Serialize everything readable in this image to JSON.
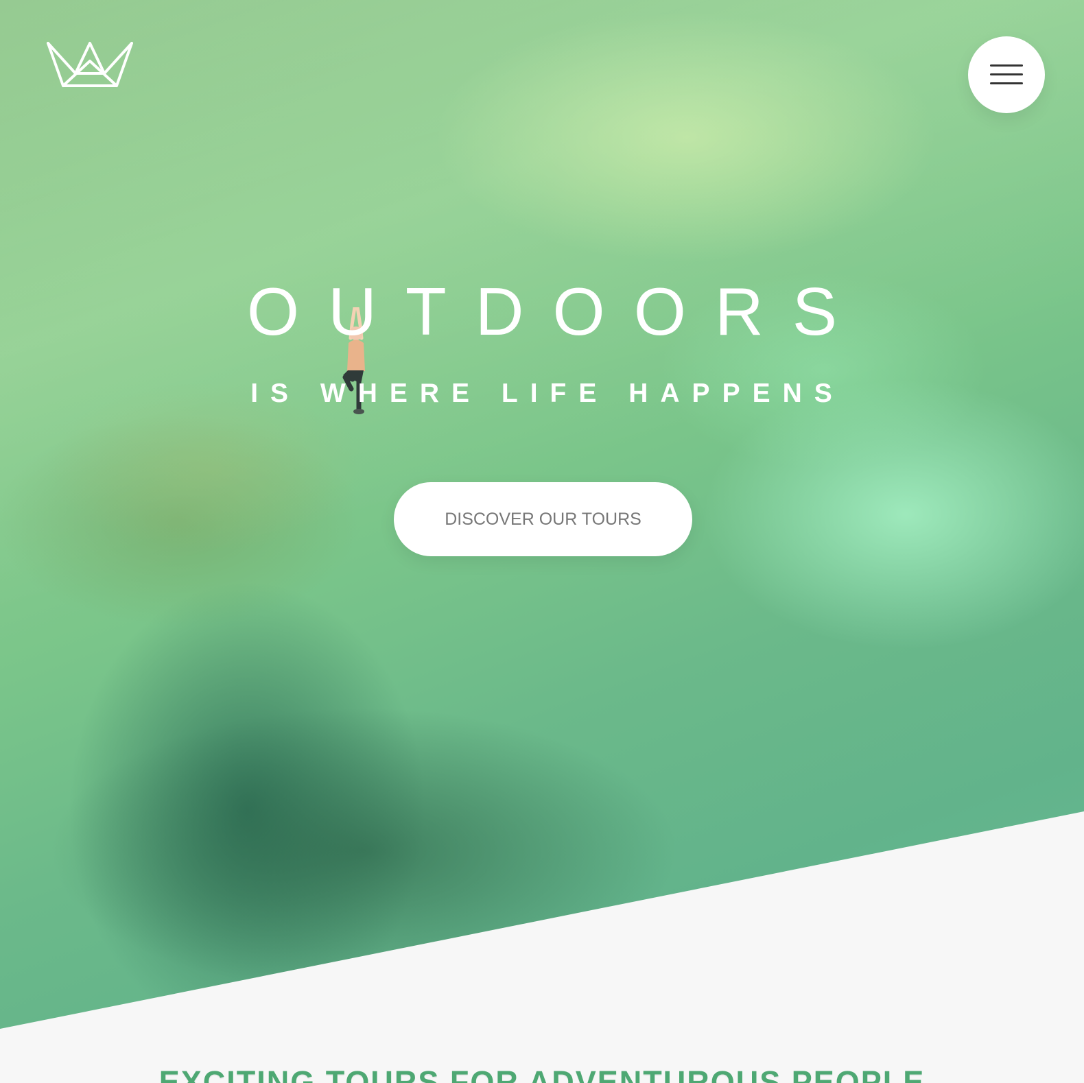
{
  "brand": {
    "logo_icon": "crown-icon"
  },
  "header": {
    "menu_icon": "menu-icon"
  },
  "hero": {
    "title": "OUTDOORS",
    "subtitle": "IS WHERE LIFE HAPPENS",
    "cta_label": "DISCOVER OUR TOURS",
    "overlay_color": "#7fcf98"
  },
  "section": {
    "heading": "EXCITING TOURS FOR ADVENTUROUS PEOPLE",
    "heading_color": "#4ea873"
  }
}
